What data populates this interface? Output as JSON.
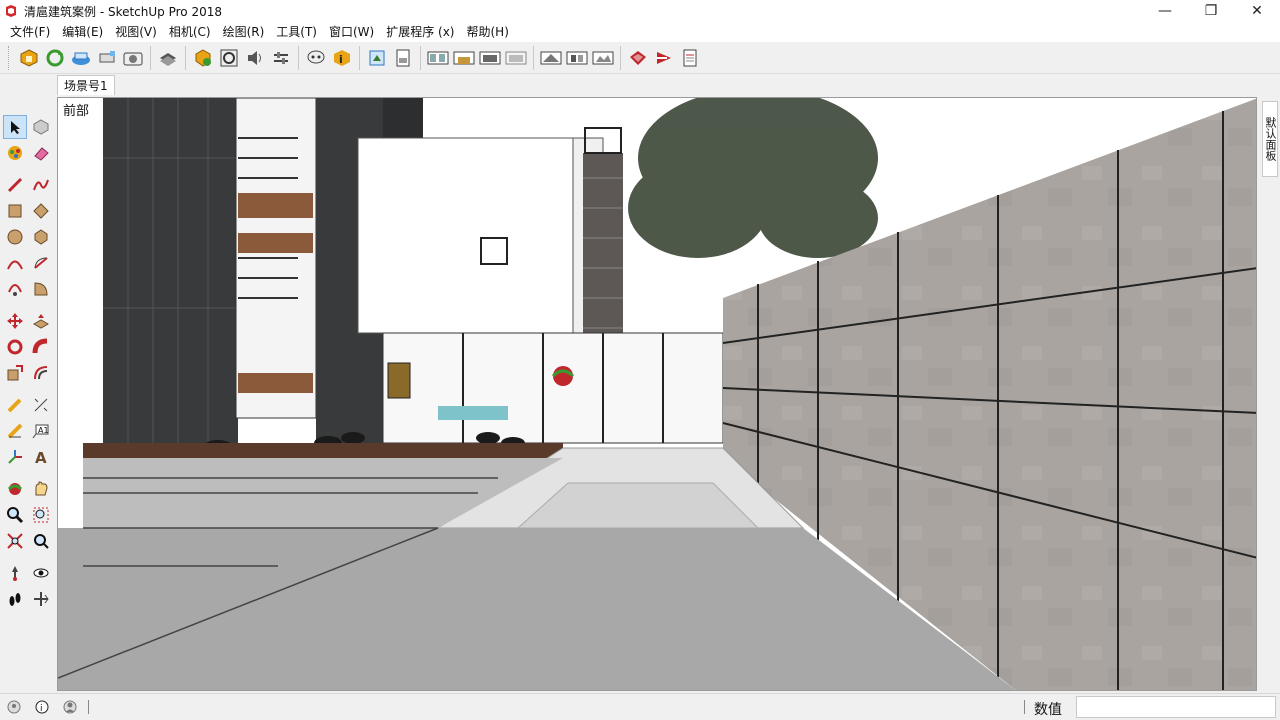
{
  "window": {
    "title": "清扈建筑案例 - SketchUp Pro 2018"
  },
  "menu": [
    "文件(F)",
    "编辑(E)",
    "视图(V)",
    "相机(C)",
    "绘图(R)",
    "工具(T)",
    "窗口(W)",
    "扩展程序 (x)",
    "帮助(H)"
  ],
  "scene": {
    "tab": "场景号1",
    "view_label": "前部"
  },
  "tray": {
    "label": "默认面板"
  },
  "status": {
    "vcb_label": "数值",
    "vcb_value": ""
  },
  "colors": {
    "accent": "#2f77c2",
    "wall_block": "#a9a49f",
    "floor": "#a8a8a8",
    "dark_panel": "#383a3b"
  },
  "toolbar_icons": [
    "warehouse-icon",
    "refresh-icon",
    "share-icon",
    "extension-icon",
    "camera-icon",
    "layers-icon",
    "shield-add-icon",
    "settings-gear-icon",
    "sound-icon",
    "sliders-icon",
    "chat-icon",
    "info-icon",
    "import-icon",
    "export-icon",
    "scene-1-icon",
    "scene-2-icon",
    "scene-3-icon",
    "scene-4-icon",
    "scene-5-icon",
    "scene-6-icon",
    "scene-7-icon",
    "ruby-icon",
    "ruby-console-icon",
    "document-icon"
  ]
}
